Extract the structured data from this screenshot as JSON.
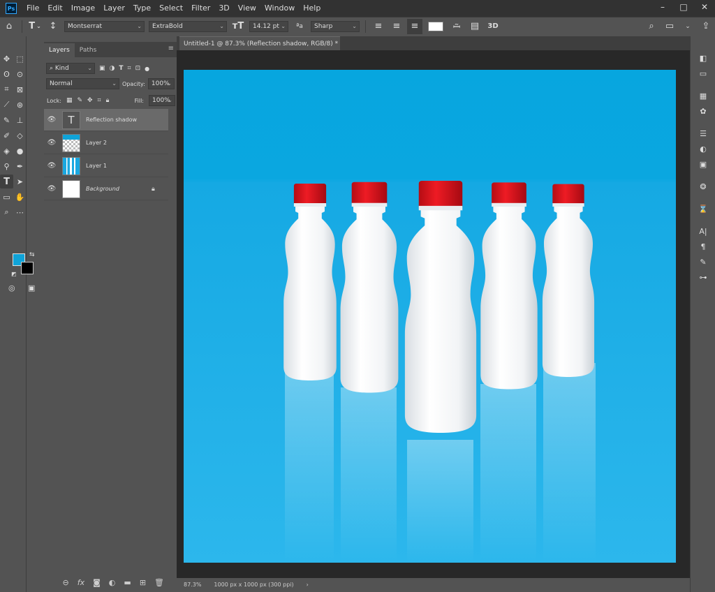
{
  "app": {
    "logo": "Ps"
  },
  "menu": [
    "File",
    "Edit",
    "Image",
    "Layer",
    "Type",
    "Select",
    "Filter",
    "3D",
    "View",
    "Window",
    "Help"
  ],
  "window_controls": [
    "–",
    "□",
    "✕"
  ],
  "options": {
    "font_family": "Montserrat",
    "font_style": "ExtraBold",
    "font_size": "14.12 pt",
    "antialias_label": "ªa",
    "antialias": "Sharp",
    "threed_label": "3D",
    "text_color": "#ffffff"
  },
  "toolbar": {
    "foreground_color": "#0fa3d8",
    "background_color": "#000000"
  },
  "layers_panel": {
    "tabs": [
      "Layers",
      "Paths"
    ],
    "filter_kind": "Kind",
    "blend_mode": "Normal",
    "opacity_label": "Opacity:",
    "opacity": "100%",
    "lock_label": "Lock:",
    "fill_label": "Fill:",
    "fill": "100%",
    "layers": [
      {
        "name": "Reflection shadow",
        "type": "text",
        "selected": true
      },
      {
        "name": "Layer 2",
        "type": "transparent",
        "selected": false
      },
      {
        "name": "Layer 1",
        "type": "image",
        "selected": false
      },
      {
        "name": "Background",
        "type": "background",
        "selected": false
      }
    ]
  },
  "document": {
    "tab_title": "Untitled-1 @ 87.3% (Reflection shadow, RGB/8) *",
    "close_glyph": "×",
    "zoom": "87.3%",
    "info": "1000 px x 1000 px (300 ppi)"
  },
  "colors": {
    "canvas_blue": "#0fa9e3",
    "cap_red": "#e0101a",
    "bottle_white": "#f4f6f8"
  }
}
